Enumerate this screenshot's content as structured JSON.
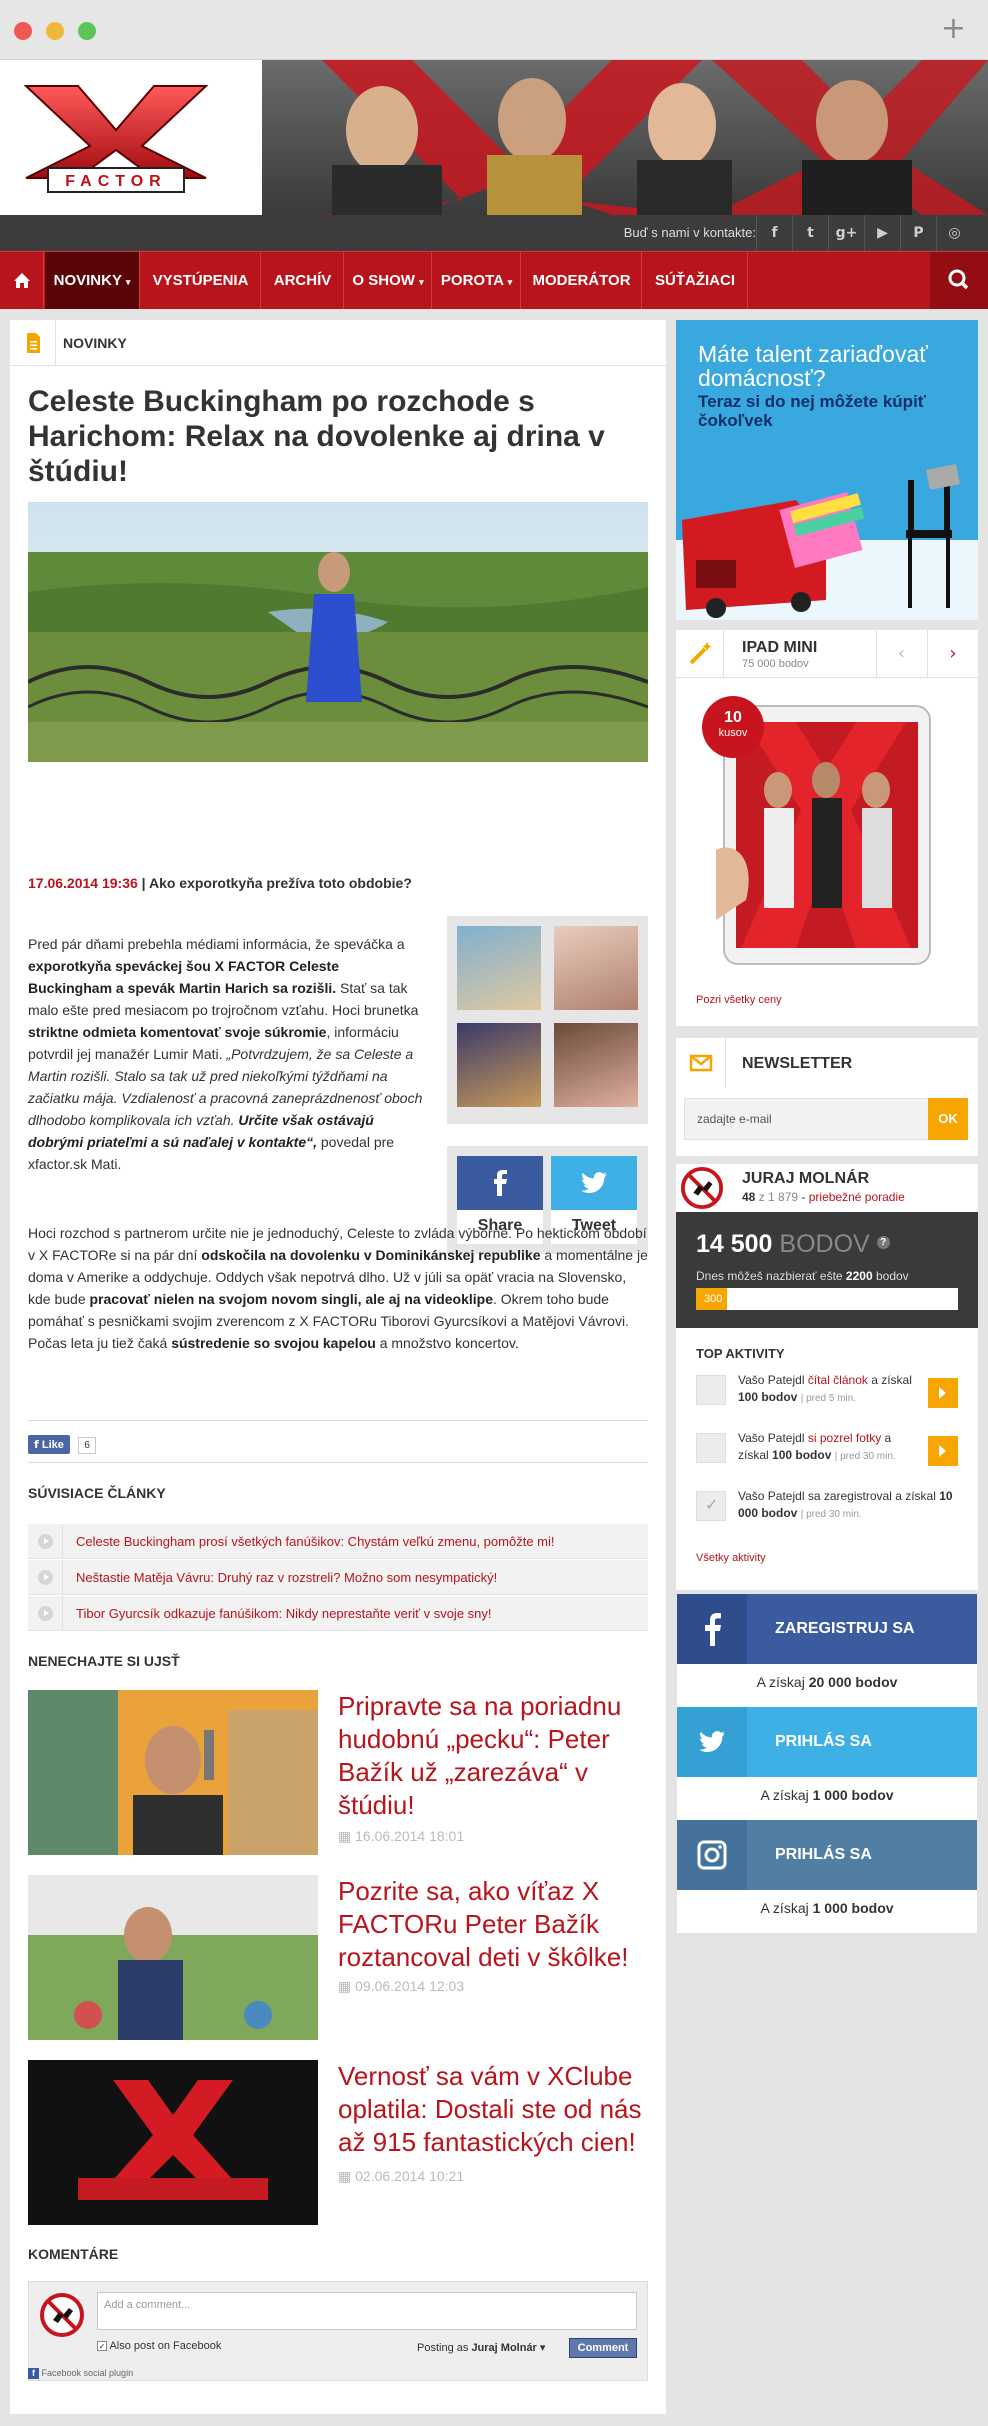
{
  "nav": {
    "social_label": "Buď s nami v kontakte:",
    "social_icons": [
      "f",
      "t",
      "g+",
      "▶",
      "P",
      "◎"
    ],
    "items": [
      "NOVINKY",
      "VYSTÚPENIA",
      "ARCHÍV",
      "O SHOW",
      "POROTA",
      "MODERÁTOR",
      "SÚŤAŽIACI"
    ]
  },
  "logo": {
    "text": "FACTOR"
  },
  "breadcrumb": "NOVINKY",
  "article": {
    "title": "Celeste Buckingham po rozchode s Harichom: Relax na dovolenke aj drina v štúdiu!",
    "date": "17.06.2014 19:36",
    "sep": " | ",
    "lead": "Ako exporotkyňa prežíva toto obdobie?"
  },
  "share": {
    "fb": "Share",
    "tw": "Tweet"
  },
  "fb_like": {
    "label": "Like",
    "count": "6"
  },
  "related": {
    "title": "SÚVISIACE ČLÁNKY",
    "items": [
      "Celeste Buckingham prosí všetkých fanúšikov: Chystám veľkú zmenu, pomôžte mi!",
      "Neštastie Matěja Vávru: Druhý raz v rozstreli? Možno som nesympatický!",
      "Tibor Gyurcsík odkazuje fanúšikom: Nikdy neprestaňte veriť v svoje sny!"
    ]
  },
  "dont_miss": {
    "title": "NENECHAJTE SI UJSŤ",
    "items": [
      {
        "title": "Pripravte sa na poriadnu hudobnú „pecku“: Peter Bažík už „zarezáva“ v štúdiu!",
        "date": "16.06.2014 18:01"
      },
      {
        "title": "Pozrite sa, ako víťaz X FACTORu Peter Bažík roztancoval deti v škôlke!",
        "date": "09.06.2014 12:03"
      },
      {
        "title": "Vernosť sa vám v XClube oplatila: Dostali ste od nás až 915 fantastických cien!",
        "date": "02.06.2014 10:21"
      }
    ]
  },
  "comments": {
    "title": "KOMENTÁRE",
    "placeholder": "Add a comment...",
    "also_post": "Also post on Facebook",
    "posting_as": "Posting as",
    "user": "Juraj Molnár",
    "button": "Comment",
    "plugin": "Facebook social plugin"
  },
  "ad": {
    "line1": "Máte talent zariaďovať domácnosť?",
    "line2": "Teraz si do nej môžete kúpiť čokoľvek"
  },
  "prize": {
    "name": "IPAD MINI",
    "points": "75 000 bodov",
    "badge_num": "10",
    "badge_txt": "kusov",
    "link": "Pozri všetky ceny"
  },
  "newsletter": {
    "title": "NEWSLETTER",
    "placeholder": "zadajte e-mail",
    "button": "OK"
  },
  "user": {
    "name": "JURAJ MOLNÁR",
    "rank": "48",
    "rank_of": "z 1 879",
    "ranking_link": "priebežné poradie",
    "points": "14 500",
    "points_unit": "BODOV",
    "today_prefix": "Dnes môžeš nazbierať ešte",
    "today_points": "2200",
    "today_suffix": "bodov",
    "progress_label": "300",
    "progress": 0.12
  },
  "activity": {
    "title": "TOP AKTIVITY",
    "items": [
      {
        "pre": "Vašo Patejdl",
        "link": "čítal článok",
        "mid": " a získal",
        "pts": "100 bodov",
        "ago": "| pred 5 min."
      },
      {
        "pre": "Vašo Patejdl",
        "link": "si pozrel fotky",
        "mid": " a získal",
        "pts": "100 bodov",
        "ago": "| pred 30 min."
      },
      {
        "pre": "Vašo Patejdl sa zaregistroval a získal",
        "link": "",
        "mid": "",
        "pts": "10 000 bodov",
        "ago": "| pred 30 min."
      }
    ],
    "all": "Všetky aktivity"
  },
  "cta": [
    {
      "label": "ZAREGISTRUJ SA",
      "pre": "A získaj",
      "pts": "20 000 bodov",
      "color": "#3b5ba0"
    },
    {
      "label": "PRIHLÁS SA",
      "pre": "A získaj",
      "pts": "1 000 bodov",
      "color": "#3eb0e6"
    },
    {
      "label": "PRIHLÁS SA",
      "pre": "A získaj",
      "pts": "1 000 bodov",
      "color": "#517fa4"
    }
  ],
  "colors": {
    "brand": "#b8141c",
    "accent": "#f7a500"
  }
}
